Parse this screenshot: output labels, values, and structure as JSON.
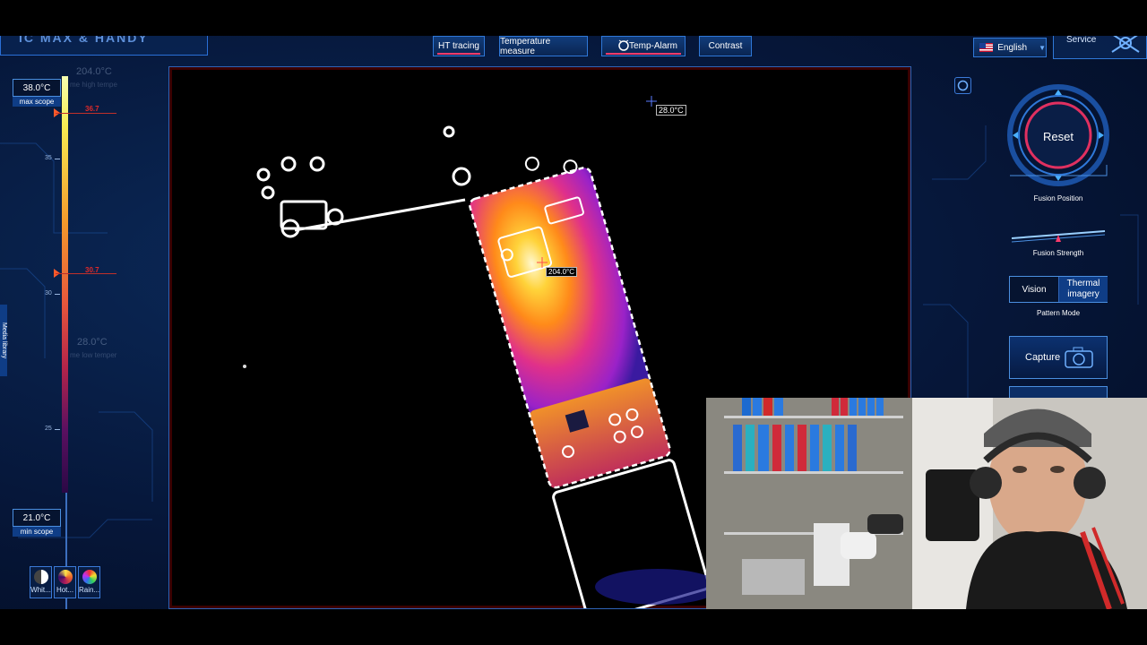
{
  "app": {
    "logo_text": "IC MAX & HANDY",
    "tabs": [
      {
        "label": "HT tracing",
        "active": true
      },
      {
        "label": "Temperature measure",
        "active": false
      },
      {
        "label": "Temp-Alarm",
        "active": true
      },
      {
        "label": "Contrast",
        "active": false
      }
    ],
    "language": "English",
    "service": "Service"
  },
  "scale": {
    "max_value": "38.0°C",
    "max_label": "max scope",
    "min_value": "21.0°C",
    "min_label": "min scope",
    "ticks": [
      "35",
      "30",
      "25"
    ],
    "ghost_high": "204.0°C",
    "ghost_high_sub": "me high tempe",
    "ghost_low": "28.0°C",
    "ghost_low_sub": "me low temper",
    "marker_high": "36.7",
    "marker_low": "30.7",
    "side_tab": "Media library",
    "palettes": [
      {
        "label": "Whit...",
        "icon": "white-hot-palette-icon",
        "color": "#bfbfbf"
      },
      {
        "label": "Hot...",
        "icon": "iron-palette-icon",
        "color": "#f0a030"
      },
      {
        "label": "Rain...",
        "icon": "rainbow-palette-icon",
        "color": "#3ad06a"
      }
    ]
  },
  "thermal": {
    "cursor_temp": "28.0°C",
    "hotspot_temp": "204.0°C"
  },
  "controls": {
    "reset": "Reset",
    "fusion_position": "Fusion Position",
    "fusion_strength": "Fusion Strength",
    "vision": "Vision",
    "thermal_imagery": "Thermal imagery",
    "pattern_mode": "Pattern Mode",
    "capture": "Capture"
  },
  "colors": {
    "accent": "#2f78d8",
    "alarm": "#ff3b6b",
    "panel_bg": "#06173a"
  }
}
